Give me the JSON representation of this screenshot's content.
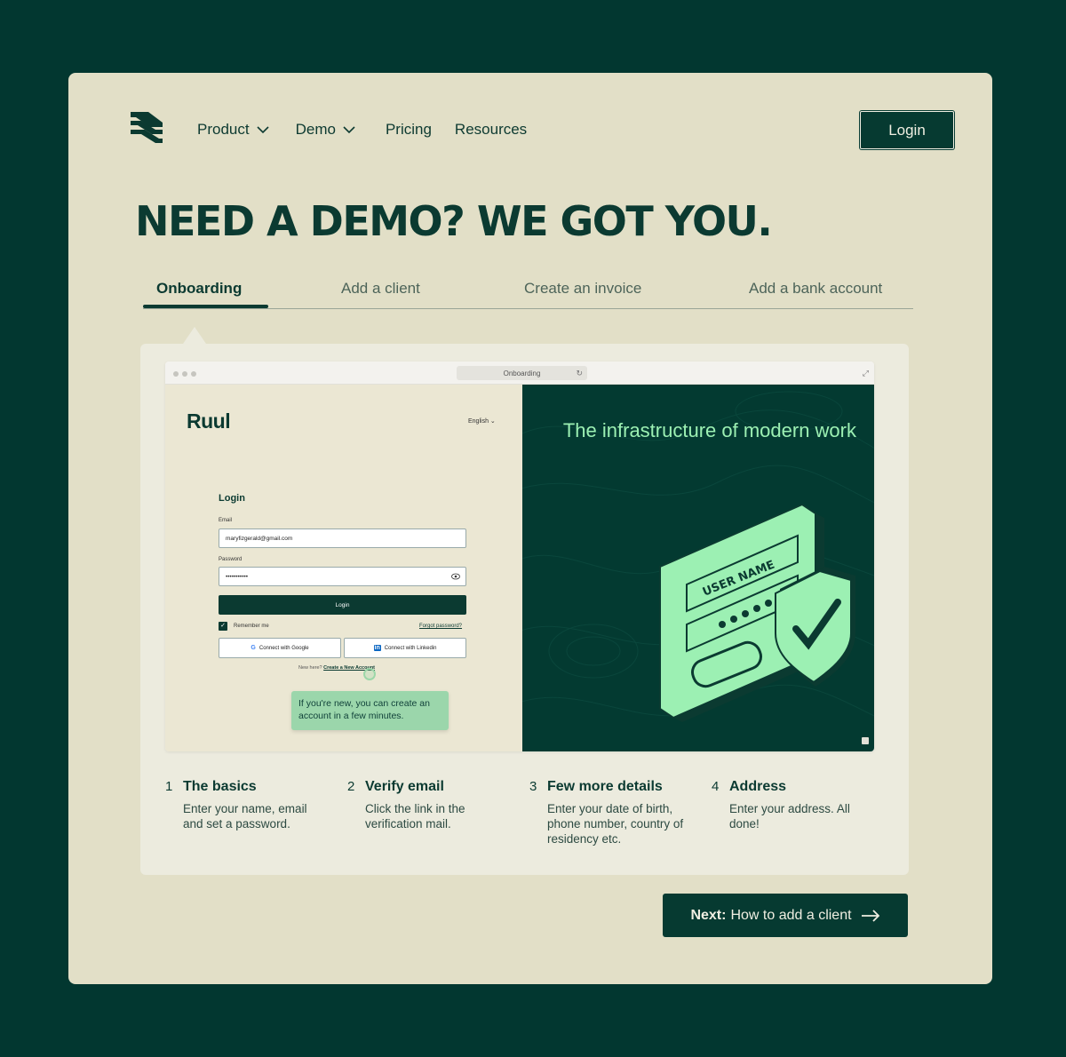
{
  "nav": {
    "items": [
      {
        "label": "Product",
        "has_dropdown": true
      },
      {
        "label": "Demo",
        "has_dropdown": true
      },
      {
        "label": "Pricing",
        "has_dropdown": false
      },
      {
        "label": "Resources",
        "has_dropdown": false
      }
    ],
    "login_label": "Login"
  },
  "headline": "NEED A DEMO? WE GOT YOU.",
  "tabs": [
    {
      "label": "Onboarding",
      "active": true
    },
    {
      "label": "Add a client",
      "active": false
    },
    {
      "label": "Create an invoice",
      "active": false
    },
    {
      "label": "Add a bank account",
      "active": false
    }
  ],
  "browser": {
    "url_title": "Onboarding",
    "app_logo": "Ruul",
    "language": "English",
    "login_title": "Login",
    "email_label": "Email",
    "email_value": "maryfizgerald@gmail.com",
    "password_label": "Password",
    "password_value": "•••••••••••",
    "login_button": "Login",
    "remember_me": "Remember me",
    "forgot_password": "Forgot password?",
    "connect_google": "Connect with Google",
    "connect_linkedin": "Connect with Linkedin",
    "new_here": "New here?",
    "create_account": "Create a New Account",
    "tooltip": "If you're new, you can create an account in a few minutes.",
    "tagline": "The infrastructure of modern work",
    "illustration_text": "USER NAME"
  },
  "steps": [
    {
      "num": "1",
      "title": "The basics",
      "desc": "Enter your name, email and set a password."
    },
    {
      "num": "2",
      "title": "Verify email",
      "desc": "Click the link in the verification mail."
    },
    {
      "num": "3",
      "title": "Few more details",
      "desc": "Enter your date of birth, phone number, country of residency etc."
    },
    {
      "num": "4",
      "title": "Address",
      "desc": "Enter your address. All done!"
    }
  ],
  "next": {
    "prefix": "Next:",
    "label": "How to add a client"
  },
  "colors": {
    "background": "#023730",
    "card": "#e2dfc7",
    "accent": "#9cf0b3",
    "primary": "#063a31"
  }
}
